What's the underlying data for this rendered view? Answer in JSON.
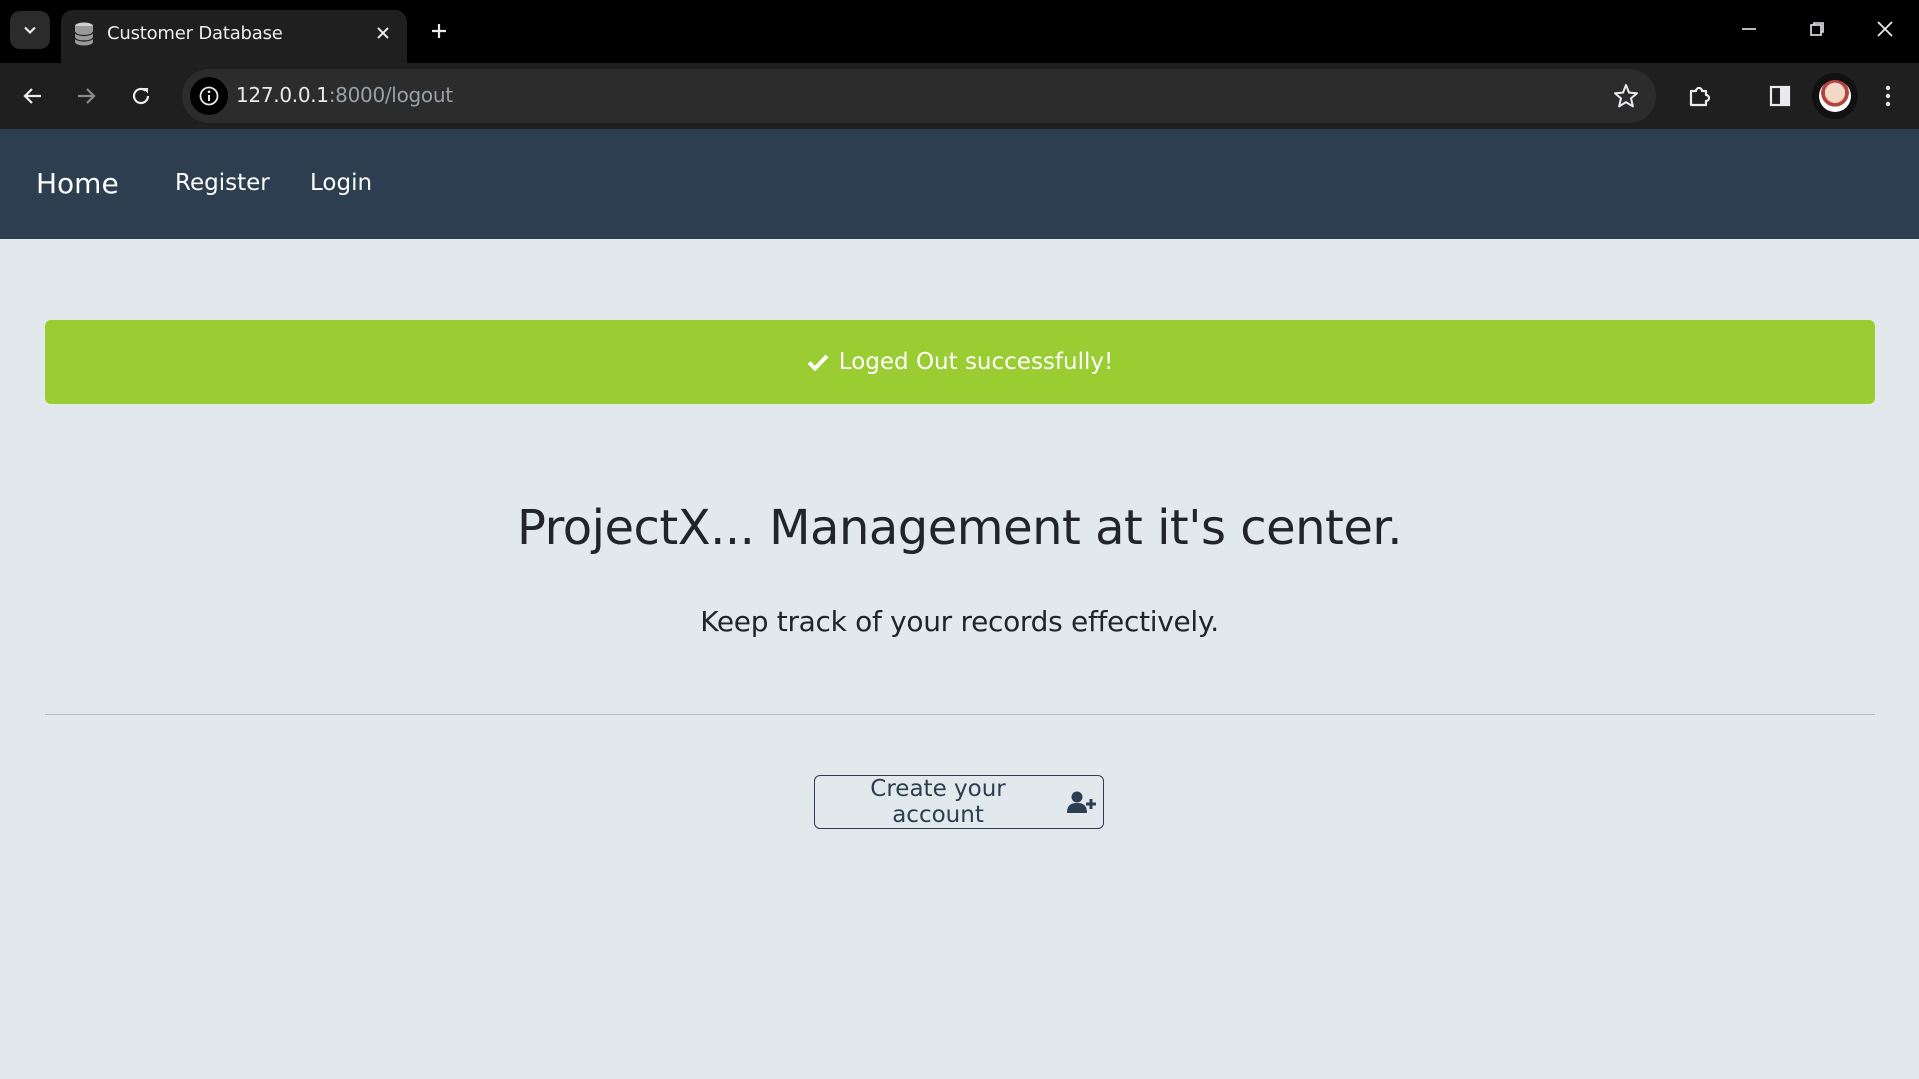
{
  "browser": {
    "tab_title": "Customer Database",
    "url_host": "127.0.0.1",
    "url_rest": ":8000/logout"
  },
  "navbar": {
    "brand": "Home",
    "links": [
      "Register",
      "Login"
    ]
  },
  "alert": {
    "message": "Loged Out successfully!",
    "color": "#9acd32"
  },
  "hero": {
    "title": "ProjectX... Management at it's center.",
    "subtitle": "Keep track of your records effectively."
  },
  "cta": {
    "label": "Create your account",
    "icon": "user-plus-icon"
  },
  "colors": {
    "navbar_bg": "#2c3e50",
    "page_bg": "#e1e9ec"
  }
}
